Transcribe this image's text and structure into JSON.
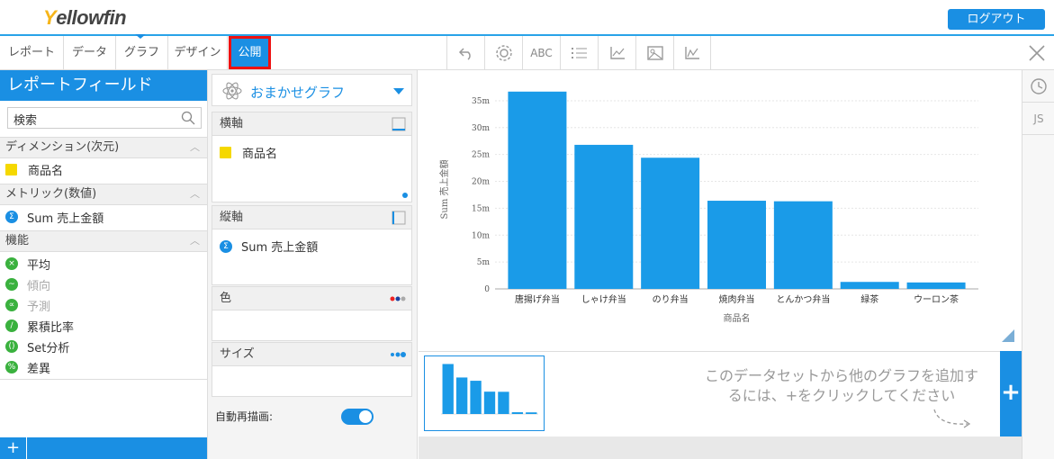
{
  "header": {
    "logo_y": "Y",
    "logo_rest": "ellowfin",
    "logout_label": "ログアウト"
  },
  "tabs": [
    {
      "label": "レポート"
    },
    {
      "label": "データ"
    },
    {
      "label": "グラフ"
    },
    {
      "label": "デザイン"
    },
    {
      "label": "公開",
      "active": true
    }
  ],
  "toolbar": {
    "undo_icon": "undo-icon",
    "abc_label": "ABC",
    "icons": [
      "undo-icon",
      "settings-icon",
      "text-icon",
      "list-icon",
      "axis-icon",
      "image-icon",
      "line-chart-icon"
    ]
  },
  "left_panel": {
    "title": "レポートフィールド",
    "search_value": "検索",
    "dimension_header": "ディメンション(次元)",
    "dimension_items": [
      "商品名"
    ],
    "metric_header": "メトリック(数値)",
    "metric_items": [
      "Sum 売上金額"
    ],
    "function_header": "機能",
    "functions": [
      {
        "label": "平均",
        "enabled": true
      },
      {
        "label": "傾向",
        "enabled": false
      },
      {
        "label": "予測",
        "enabled": false
      },
      {
        "label": "累積比率",
        "enabled": true
      },
      {
        "label": "Set分析",
        "enabled": true
      },
      {
        "label": "差異",
        "enabled": true
      }
    ],
    "add_label": "+"
  },
  "middle_panel": {
    "chart_type": "おまかせグラフ",
    "x_axis_header": "横軸",
    "x_axis_field": "商品名",
    "y_axis_header": "縦軸",
    "y_axis_field": "Sum 売上金額",
    "color_header": "色",
    "size_header": "サイズ",
    "auto_redraw_label": "自動再描画:"
  },
  "chart_data": {
    "type": "bar",
    "categories": [
      "唐揚げ弁当",
      "しゃけ弁当",
      "のり弁当",
      "焼肉弁当",
      "とんかつ弁当",
      "緑茶",
      "ウーロン茶"
    ],
    "values": [
      36.7,
      26.8,
      24.4,
      16.4,
      16.3,
      1.3,
      1.2
    ],
    "value_unit": "m",
    "xlabel": "商品名",
    "ylabel": "Sum 売上金額",
    "ylim": [
      0,
      37
    ],
    "yticks": [
      "0",
      "5m",
      "10m",
      "15m",
      "20m",
      "25m",
      "30m",
      "35m"
    ],
    "ytick_values": [
      0,
      5,
      10,
      15,
      20,
      25,
      30,
      35
    ],
    "color": "#1a9be8",
    "grid": true
  },
  "thumb_panel": {
    "hint_line1": "このデータセットから他のグラフを追加す",
    "hint_line2": "るには、+をクリックしてください",
    "add_label": "+"
  },
  "right_rail": {
    "js_label": "JS"
  },
  "colors": {
    "accent": "#1a8fe3",
    "logo_yellow": "#f6b519",
    "highlight_red": "#e11111"
  }
}
